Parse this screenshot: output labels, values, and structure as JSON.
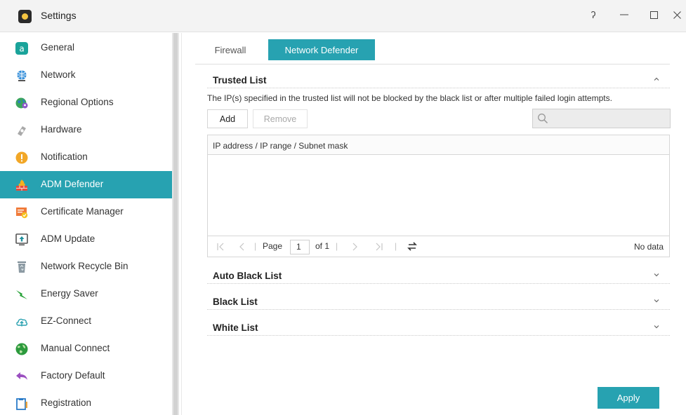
{
  "window": {
    "title": "Settings",
    "controls": {
      "help": "ʔ",
      "minimize": "—",
      "maximize": "☐",
      "close": "✕"
    }
  },
  "sidebar": {
    "items": [
      {
        "label": "General",
        "icon": "general-icon"
      },
      {
        "label": "Network",
        "icon": "network-icon"
      },
      {
        "label": "Regional Options",
        "icon": "regional-options-icon"
      },
      {
        "label": "Hardware",
        "icon": "hardware-icon"
      },
      {
        "label": "Notification",
        "icon": "notification-icon"
      },
      {
        "label": "ADM Defender",
        "icon": "adm-defender-icon",
        "active": true
      },
      {
        "label": "Certificate Manager",
        "icon": "certificate-icon"
      },
      {
        "label": "ADM Update",
        "icon": "adm-update-icon"
      },
      {
        "label": "Network Recycle Bin",
        "icon": "recycle-bin-icon"
      },
      {
        "label": "Energy Saver",
        "icon": "energy-saver-icon"
      },
      {
        "label": "EZ-Connect",
        "icon": "ez-connect-icon"
      },
      {
        "label": "Manual Connect",
        "icon": "manual-connect-icon"
      },
      {
        "label": "Factory Default",
        "icon": "factory-default-icon"
      },
      {
        "label": "Registration",
        "icon": "registration-icon"
      }
    ]
  },
  "tabs": [
    {
      "label": "Firewall",
      "active": false
    },
    {
      "label": "Network Defender",
      "active": true
    }
  ],
  "trusted": {
    "title": "Trusted List",
    "description": "The IP(s) specified in the trusted list will not be blocked by the black list or after multiple failed login attempts.",
    "add_label": "Add",
    "remove_label": "Remove",
    "column": "IP address / IP range / Subnet mask",
    "pager": {
      "page_label": "Page",
      "page_value": "1",
      "of_label": "of 1",
      "sep": "|",
      "status": "No data"
    }
  },
  "sections": {
    "auto_black": "Auto Black List",
    "black": "Black List",
    "white": "White List"
  },
  "footer": {
    "apply_label": "Apply"
  },
  "colors": {
    "accent": "#27a2b1"
  }
}
